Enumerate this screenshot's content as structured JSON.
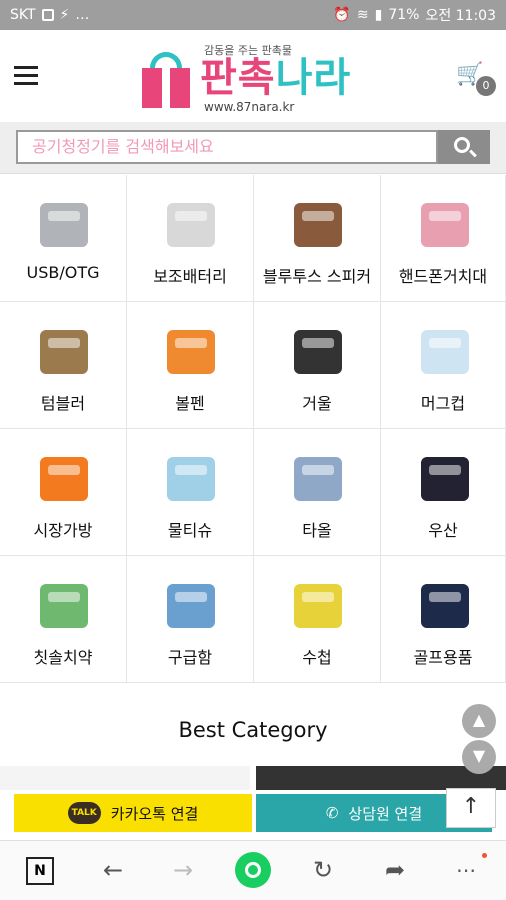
{
  "status_bar": {
    "carrier": "SKT",
    "battery": "71%",
    "time": "오전 11:03"
  },
  "header": {
    "slogan": "감동을 주는 판촉물",
    "brand_pink": "판촉",
    "brand_teal": "나라",
    "url": "www.87nara.kr",
    "cart_count": "0"
  },
  "search": {
    "placeholder": "공기청정기를 검색해보세요"
  },
  "categories": [
    {
      "label": "USB/OTG",
      "icon": "usb-icon"
    },
    {
      "label": "보조배터리",
      "icon": "battery-icon"
    },
    {
      "label": "블루투스 스피커",
      "icon": "speaker-icon"
    },
    {
      "label": "핸드폰거치대",
      "icon": "phone-stand-icon"
    },
    {
      "label": "텀블러",
      "icon": "tumbler-icon"
    },
    {
      "label": "볼펜",
      "icon": "pen-icon"
    },
    {
      "label": "거울",
      "icon": "mirror-icon"
    },
    {
      "label": "머그컵",
      "icon": "mug-icon"
    },
    {
      "label": "시장가방",
      "icon": "bag-icon"
    },
    {
      "label": "물티슈",
      "icon": "wet-tissue-icon"
    },
    {
      "label": "타올",
      "icon": "towel-icon"
    },
    {
      "label": "우산",
      "icon": "umbrella-icon"
    },
    {
      "label": "칫솔치약",
      "icon": "toothbrush-icon"
    },
    {
      "label": "구급함",
      "icon": "first-aid-icon"
    },
    {
      "label": "수첩",
      "icon": "notebook-icon"
    },
    {
      "label": "골프용품",
      "icon": "golf-icon"
    }
  ],
  "best_category": {
    "title": "Best Category"
  },
  "contact": {
    "kakao_badge": "TALK",
    "kakao_label": "카카오톡 연결",
    "call_label": "상담원 연결"
  },
  "browser_nav": {
    "home_label": "N"
  },
  "colors": {
    "pink": "#e8457a",
    "teal": "#2ec1c4",
    "kakao": "#f9e000",
    "call": "#2aa6a8",
    "naver": "#19ce60"
  }
}
